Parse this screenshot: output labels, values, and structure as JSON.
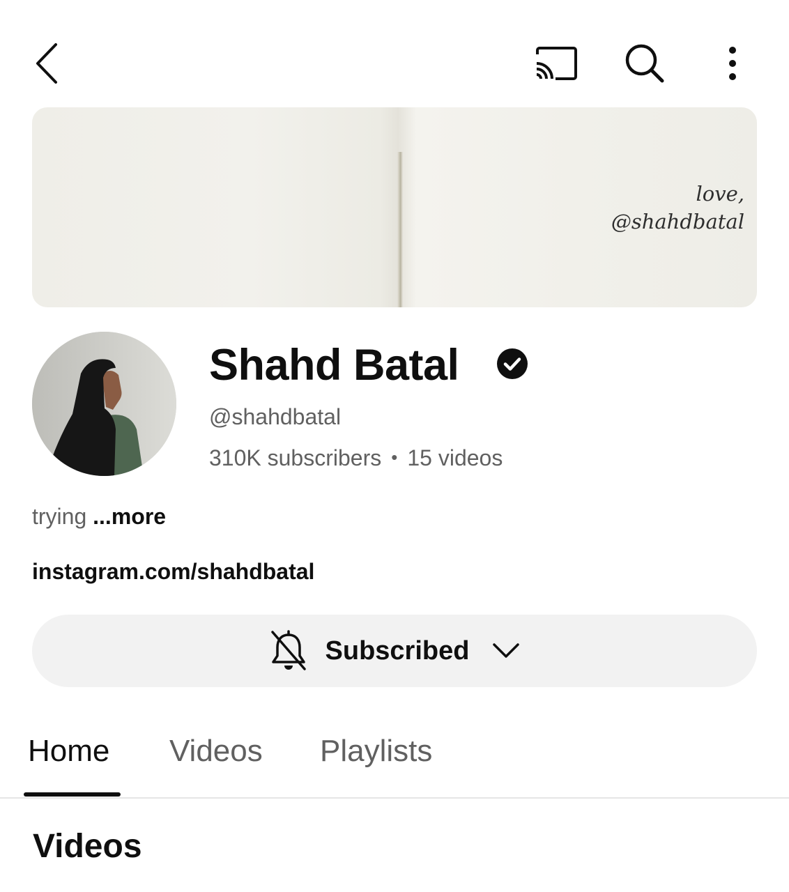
{
  "topbar": {
    "icons": [
      "back-icon",
      "cast-icon",
      "search-icon",
      "more-vert-icon"
    ]
  },
  "banner": {
    "line1": "love,",
    "line2": "@shahdbatal"
  },
  "channel": {
    "name": "Shahd Batal",
    "handle": "@shahdbatal",
    "subscribers": "310K subscribers",
    "separator": "•",
    "videos": "15 videos",
    "description": "trying",
    "more": "...more",
    "link": "instagram.com/shahdbatal"
  },
  "subscribe_button": {
    "label": "Subscribed",
    "bell_icon": "bell-off-icon",
    "dropdown_icon": "chevron-down-icon"
  },
  "tabs": [
    {
      "label": "Home",
      "active": true
    },
    {
      "label": "Videos",
      "active": false
    },
    {
      "label": "Playlists",
      "active": false
    }
  ],
  "section": {
    "title": "Videos"
  },
  "colors": {
    "text_primary": "#0f0f0f",
    "text_secondary": "#606060",
    "button_bg": "#f2f2f2",
    "divider": "#e5e5e5"
  }
}
